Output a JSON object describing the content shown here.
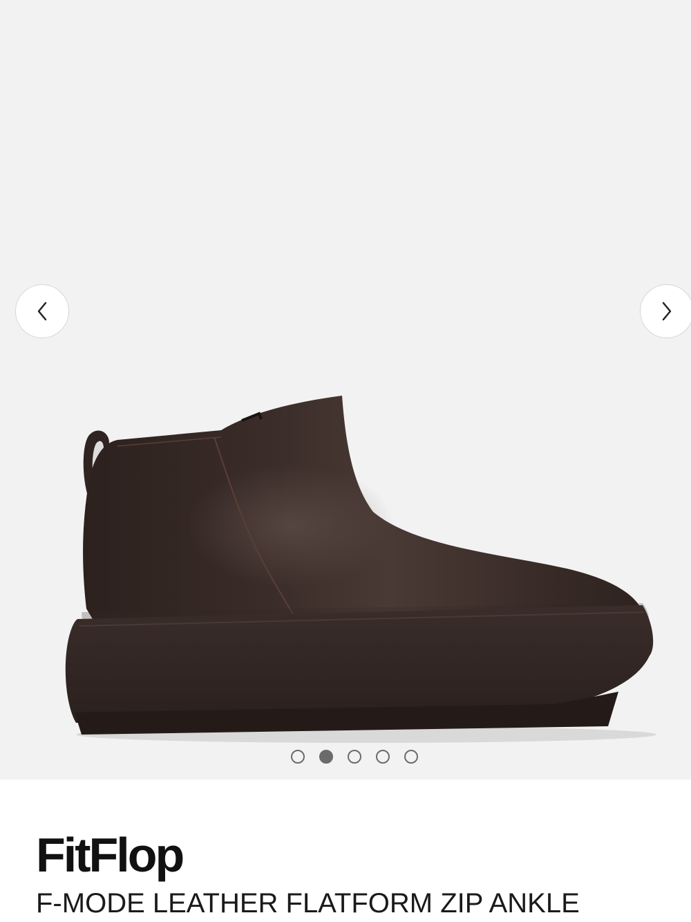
{
  "gallery": {
    "image_alt": "F-MODE LEATHER FLATFORM ZIP ANKLE boot, dark brown",
    "image_subject": "dark-brown-ankle-boot",
    "prev_icon": "chevron-left-icon",
    "next_icon": "chevron-right-icon",
    "slide_count": 5,
    "active_slide": 2,
    "colors": {
      "background": "#f2f2f2",
      "boot": "#3a2c28",
      "dot": "#6b6b6b"
    }
  },
  "product": {
    "brand": "FitFlop",
    "name": "F-MODE LEATHER FLATFORM ZIP ANKLE"
  }
}
